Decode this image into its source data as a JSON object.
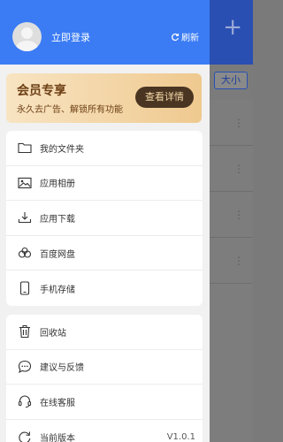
{
  "background": {
    "plus_icon": "plus-icon",
    "sort_label": "大小",
    "row_dots": [
      "⋮",
      "⋮",
      "⋮",
      "⋮"
    ]
  },
  "drawer": {
    "header": {
      "login_label": "立即登录",
      "refresh_label": "刷新",
      "accent_color": "#3b7cf5"
    },
    "vip": {
      "title": "会员专享",
      "subtitle": "永久去广告、解锁所有功能",
      "button_label": "查看详情"
    },
    "menu_primary": [
      {
        "label": "我的文件夹",
        "icon": "folder-icon"
      },
      {
        "label": "应用相册",
        "icon": "image-icon"
      },
      {
        "label": "应用下载",
        "icon": "download-icon"
      },
      {
        "label": "百度网盘",
        "icon": "cloud-icon"
      },
      {
        "label": "手机存储",
        "icon": "phone-icon"
      }
    ],
    "menu_secondary": [
      {
        "label": "回收站",
        "icon": "trash-icon"
      },
      {
        "label": "建议与反馈",
        "icon": "chat-icon"
      },
      {
        "label": "在线客服",
        "icon": "headset-icon"
      },
      {
        "label": "当前版本",
        "icon": "refresh-icon",
        "value": "V1.0.1"
      }
    ]
  }
}
